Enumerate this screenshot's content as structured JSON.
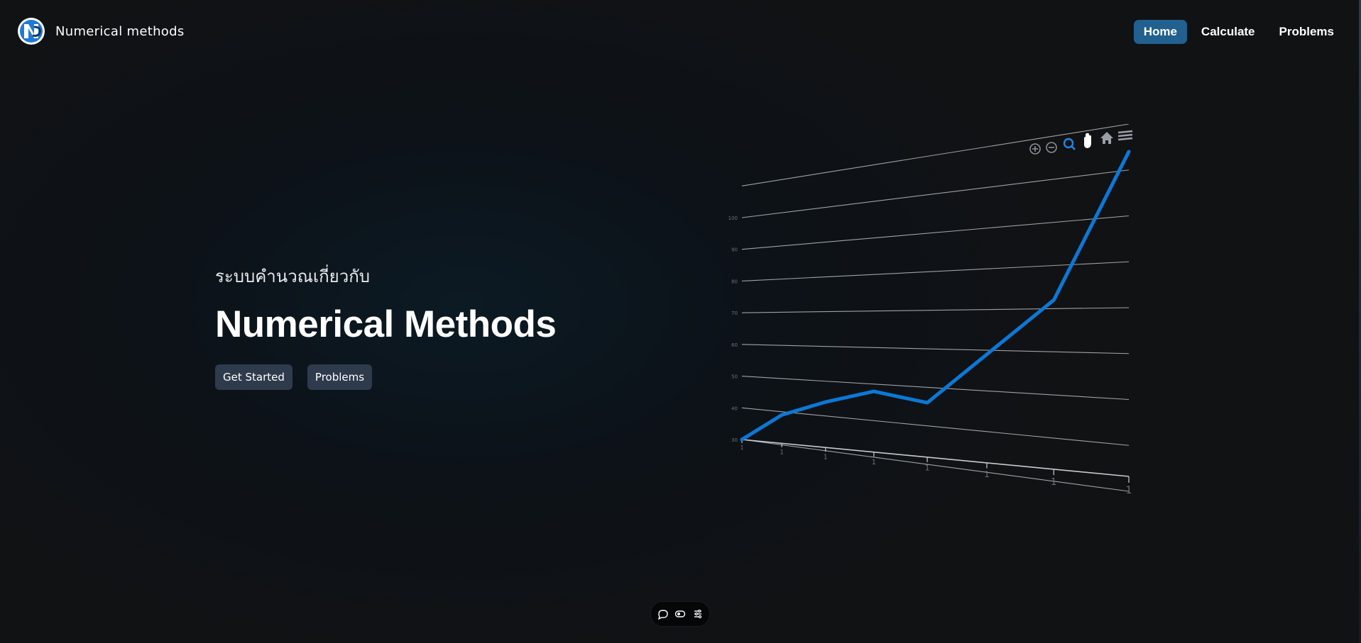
{
  "navbar": {
    "brand": "Numerical methods",
    "links": [
      "Home",
      "Calculate",
      "Problems"
    ],
    "active": "Home"
  },
  "hero": {
    "subtitle": "ระบบคำนวณเกี่ยวกับ",
    "title": "Numerical Methods",
    "buttons": [
      "Get Started",
      "Problems"
    ]
  },
  "chart_toolbar_icons": [
    "zoom-in-icon",
    "zoom-out-icon",
    "selection-zoom-icon",
    "pan-icon",
    "home-icon",
    "menu-icon"
  ],
  "bottom_toolbar_icons": [
    "comment-icon",
    "toggle-icon",
    "sliders-icon"
  ],
  "chart_data": {
    "type": "line",
    "title": "",
    "xlabel": "",
    "ylabel": "",
    "x": [
      "1",
      "1",
      "1",
      "1",
      "1",
      "1",
      "1",
      "1"
    ],
    "series": [
      {
        "values": [
          30,
          39,
          44,
          48,
          46,
          59,
          72,
          104
        ]
      }
    ],
    "y_ticks": [
      "30",
      "40",
      "50",
      "60",
      "70",
      "80",
      "90",
      "100"
    ],
    "ylim": [
      30,
      110
    ],
    "grid": true,
    "legend": "none",
    "colors": {
      "line": "#0b78d6",
      "grid": "#b9bcbf",
      "axis_text": "#6d7276"
    }
  },
  "colors": {
    "accent": "#21608f",
    "button": "#2e3b4c"
  }
}
